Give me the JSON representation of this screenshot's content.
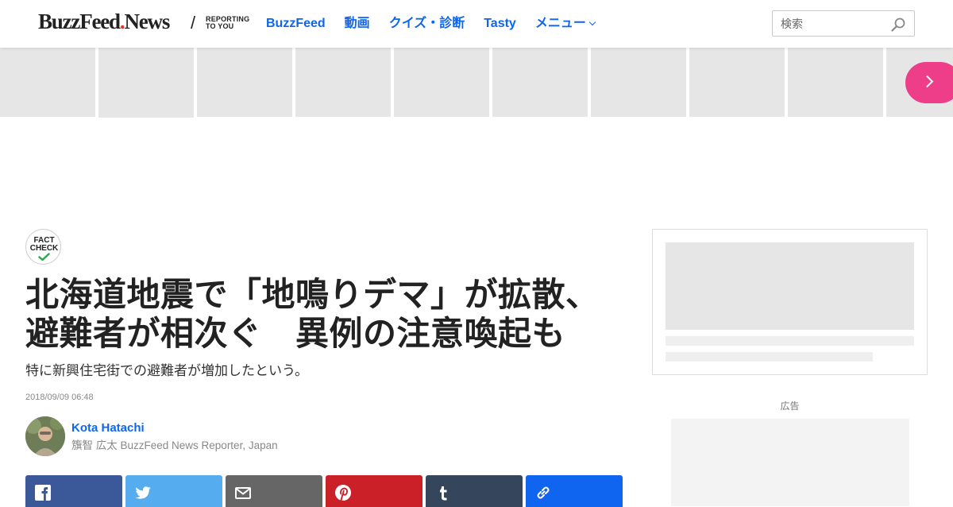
{
  "header": {
    "logo": {
      "part1": "BuzzFeed",
      "part2": "News",
      "slash": "/",
      "tagline_line1": "REPORTING",
      "tagline_line2": "TO YOU"
    },
    "nav": [
      {
        "label": "BuzzFeed"
      },
      {
        "label": "動画"
      },
      {
        "label": "クイズ・診断"
      },
      {
        "label": "Tasty"
      },
      {
        "label": "メニュー"
      }
    ],
    "search": {
      "placeholder": "検索",
      "icon": "search-icon"
    }
  },
  "carousel": {
    "next_icon": "chevron-right-icon",
    "accent": "#ee3e8a"
  },
  "article": {
    "badge": {
      "line1": "FACT",
      "line2": "CHECK",
      "icon": "checkmark-icon"
    },
    "title_line1": "北海道地震で「地鳴りデマ」が拡散、",
    "title_line2": "避難者が相次ぐ　異例の注意喚起も",
    "dek": "特に新興住宅街での避難者が増加したという。",
    "timestamp": "2018/09/09 06:48",
    "author": {
      "name": "Kota Hatachi",
      "title": "籏智 広太 BuzzFeed News Reporter, Japan"
    },
    "share": [
      {
        "network": "facebook",
        "icon": "facebook-icon",
        "color": "#3b5998"
      },
      {
        "network": "twitter",
        "icon": "twitter-icon",
        "color": "#55acee"
      },
      {
        "network": "email",
        "icon": "email-icon",
        "color": "#666666"
      },
      {
        "network": "pinterest",
        "icon": "pinterest-icon",
        "color": "#cb2027"
      },
      {
        "network": "tumblr",
        "icon": "tumblr-icon",
        "color": "#35465c"
      },
      {
        "network": "copy-link",
        "icon": "link-icon",
        "color": "#0f65ef"
      }
    ]
  },
  "sidebar": {
    "ad_label": "広告"
  }
}
